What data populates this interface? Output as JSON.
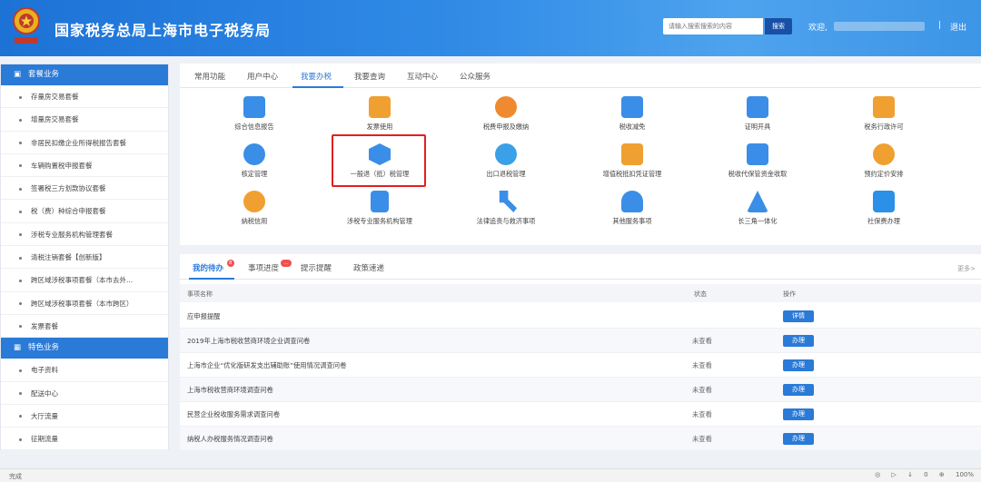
{
  "header": {
    "site_title": "国家税务总局上海市电子税务局",
    "search_placeholder": "请输入搜索搜索的内容",
    "search_button": "搜索",
    "welcome": "欢迎,",
    "divider": "|",
    "logout": "退出"
  },
  "sidebar": {
    "section1": {
      "label": "套餐业务",
      "icon": "cube-icon"
    },
    "items1": [
      "存量房交易套餐",
      "增量房交易套餐",
      "非居民扣缴企业所得税报告套餐",
      "车辆购置税申报套餐",
      "签署税三方划款协议套餐",
      "税（费）种综合申报套餐",
      "涉税专业服务机构管理套餐",
      "清税注销套餐【创新版】",
      "跨区域涉税事项套餐（本市去外...",
      "跨区域涉税事项套餐（本市跨区）",
      "发票套餐"
    ],
    "section2": {
      "label": "特色业务",
      "icon": "grid-icon"
    },
    "items2": [
      "电子资料",
      "配送中心",
      "大厅流量",
      "征期流量"
    ]
  },
  "service_tabs": [
    "常用功能",
    "用户中心",
    "我要办税",
    "我要查询",
    "互动中心",
    "公众服务"
  ],
  "active_service_tab": "我要办税",
  "services": [
    {
      "label": "综合信息报告",
      "icon": "document-icon",
      "color": "#3a8ee8"
    },
    {
      "label": "发票使用",
      "icon": "invoice-icon",
      "color": "#f0a030"
    },
    {
      "label": "税费申报及缴纳",
      "icon": "declare-icon",
      "color": "#f08a30"
    },
    {
      "label": "税收减免",
      "icon": "tax-relief-icon",
      "color": "#3a8ee8"
    },
    {
      "label": "证明开具",
      "icon": "certificate-icon",
      "color": "#3a8ee8"
    },
    {
      "label": "税务行政许可",
      "icon": "license-icon",
      "color": "#f0a030"
    },
    {
      "label": "核定管理",
      "icon": "approve-icon",
      "color": "#3a8ee8"
    },
    {
      "label": "一般退（抵）税管理",
      "icon": "refund-icon",
      "color": "#3a8ee8"
    },
    {
      "label": "出口退税管理",
      "icon": "export-refund-icon",
      "color": "#3aa0e8"
    },
    {
      "label": "增值税抵扣凭证管理",
      "icon": "vat-icon",
      "color": "#f0a030"
    },
    {
      "label": "税收代保管资金收取",
      "icon": "fund-icon",
      "color": "#3a8ee8"
    },
    {
      "label": "预约定价安排",
      "icon": "clock-icon",
      "color": "#f0a030"
    },
    {
      "label": "纳税信用",
      "icon": "credit-icon",
      "color": "#f0a030"
    },
    {
      "label": "涉税专业服务机构管理",
      "icon": "building-icon",
      "color": "#3a8ee8"
    },
    {
      "label": "法律追责与救济事项",
      "icon": "gavel-icon",
      "color": "#3a8ee8"
    },
    {
      "label": "其他服务事项",
      "icon": "heart-hand-icon",
      "color": "#3a8ee8"
    },
    {
      "label": "长三角一体化",
      "icon": "triangle-icon",
      "color": "#3a8ee8"
    },
    {
      "label": "社保费办理",
      "icon": "social-security-icon",
      "color": "#2a90e8"
    }
  ],
  "task_tabs": [
    {
      "label": "我的待办",
      "badge": "8"
    },
    {
      "label": "事项进度",
      "badge": "…"
    },
    {
      "label": "提示提醒",
      "badge": ""
    },
    {
      "label": "政策速递",
      "badge": ""
    }
  ],
  "more_link": "更多>",
  "table": {
    "headers": [
      "事项名称",
      "状态",
      "操作"
    ],
    "rows": [
      {
        "name": "应申报提醒",
        "status": "",
        "action": "详情"
      },
      {
        "name": "2019年上海市税收营商环境企业调查问卷",
        "status": "未查看",
        "action": "办理"
      },
      {
        "name": "上海市企业“优化版研发支出辅助账”使用情况调查问卷",
        "status": "未查看",
        "action": "办理"
      },
      {
        "name": "上海市税收营商环境调查问卷",
        "status": "未查看",
        "action": "办理"
      },
      {
        "name": "民营企业税收服务需求调查问卷",
        "status": "未查看",
        "action": "办理"
      },
      {
        "name": "纳税人办税服务情况调查问卷",
        "status": "未查看",
        "action": "办理"
      }
    ]
  },
  "statusbar": {
    "left": "完成",
    "zoom": "100%",
    "count": "0"
  },
  "colors": {
    "header_blue": "#2f8ae6",
    "accent": "#2a7ad8",
    "highlight_red": "#e02020"
  }
}
